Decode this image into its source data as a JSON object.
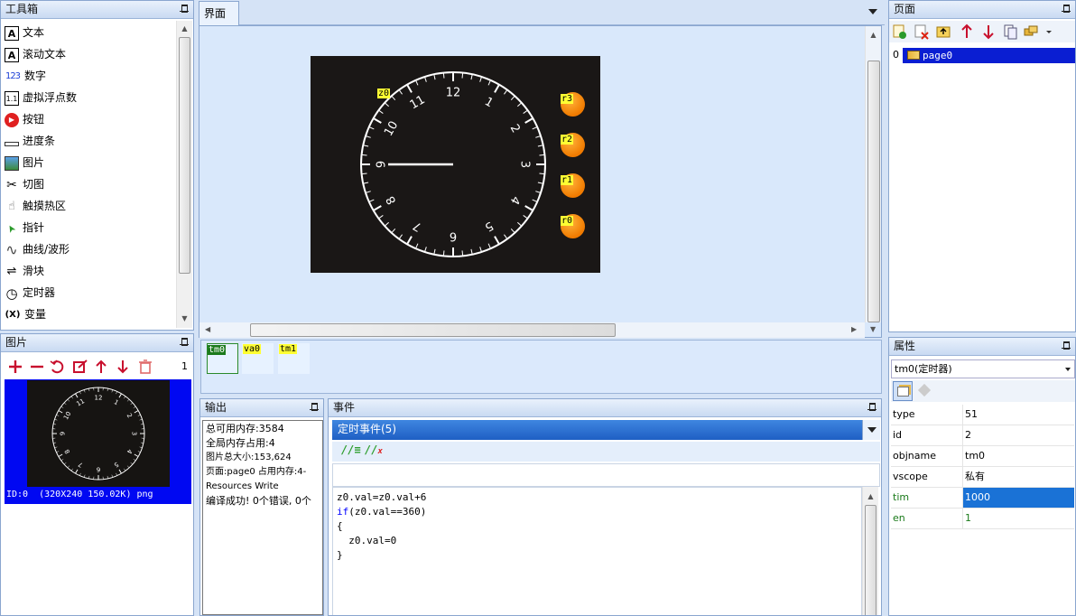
{
  "toolbox": {
    "title": "工具箱",
    "items": [
      {
        "label": "文本",
        "icon": "text-a-icon"
      },
      {
        "label": "滚动文本",
        "icon": "scroll-text-icon"
      },
      {
        "label": "数字",
        "icon": "number-icon"
      },
      {
        "label": "虚拟浮点数",
        "icon": "float-icon"
      },
      {
        "label": "按钮",
        "icon": "button-icon"
      },
      {
        "label": "进度条",
        "icon": "progress-icon"
      },
      {
        "label": "图片",
        "icon": "picture-icon"
      },
      {
        "label": "切图",
        "icon": "scissors-icon"
      },
      {
        "label": "触摸热区",
        "icon": "hand-icon"
      },
      {
        "label": "指针",
        "icon": "pointer-icon"
      },
      {
        "label": "曲线/波形",
        "icon": "wave-icon"
      },
      {
        "label": "滑块",
        "icon": "slider-icon"
      },
      {
        "label": "定时器",
        "icon": "clock-icon"
      },
      {
        "label": "变量",
        "icon": "variable-icon"
      }
    ],
    "icon_text": {
      "text": "A",
      "scroll": "A",
      "number": "123",
      "float": "1.1",
      "variable": "(X)"
    }
  },
  "pictures": {
    "title": "图片",
    "count": "1",
    "caption": "ID:0  (320X240 150.02K) png",
    "toolbar": [
      "add-icon",
      "remove-icon",
      "replace-icon",
      "edit-icon",
      "up-arrow-icon",
      "down-arrow-icon",
      "delete-icon"
    ]
  },
  "canvas": {
    "tab": "界面",
    "clock_numbers": [
      "12",
      "1",
      "2",
      "3",
      "4",
      "5",
      "6",
      "7",
      "8",
      "9",
      "10",
      "11"
    ],
    "tags": {
      "z0": "z0",
      "r3": "r3",
      "r2": "r2",
      "r1": "r1",
      "r0": "r0"
    },
    "hand_angle_deg": 270
  },
  "objects": {
    "items": [
      "tm0",
      "va0",
      "tm1"
    ]
  },
  "output": {
    "title": "输出",
    "lines": [
      "总可用内存:3584",
      "全局内存占用:4",
      "图片总大小:153,624",
      "页面:page0 占用内存:4-",
      "Resources Write",
      "编译成功! 0个错误, 0个"
    ]
  },
  "events": {
    "title": "事件",
    "dropdown": "定时事件(5)",
    "code": [
      {
        "text": "z0.val=z0.val+6",
        "kw": ""
      },
      {
        "text": "(z0.val==360)",
        "kw": "if"
      },
      {
        "text": "{",
        "kw": ""
      },
      {
        "text": "  z0.val=0",
        "kw": ""
      },
      {
        "text": "}",
        "kw": ""
      }
    ]
  },
  "pages": {
    "title": "页面",
    "items": [
      {
        "index": "0",
        "name": "page0"
      }
    ]
  },
  "properties": {
    "title": "属性",
    "selected": "tm0(定时器)",
    "rows": [
      {
        "key": "type",
        "value": "51",
        "highlight": false,
        "green": false
      },
      {
        "key": "id",
        "value": "2",
        "highlight": false,
        "green": false
      },
      {
        "key": "objname",
        "value": "tm0",
        "highlight": false,
        "green": false
      },
      {
        "key": "vscope",
        "value": "私有",
        "highlight": false,
        "green": false
      },
      {
        "key": "tim",
        "value": "1000",
        "highlight": true,
        "green": true
      },
      {
        "key": "en",
        "value": "1",
        "highlight": false,
        "green": true
      }
    ]
  },
  "colors": {
    "title_blue": "#2d6fd0",
    "selection_blue": "#0a1ed2",
    "tag_yellow": "#ffff33",
    "orange": "#f07a00",
    "code_keyword": "#0000ff"
  }
}
